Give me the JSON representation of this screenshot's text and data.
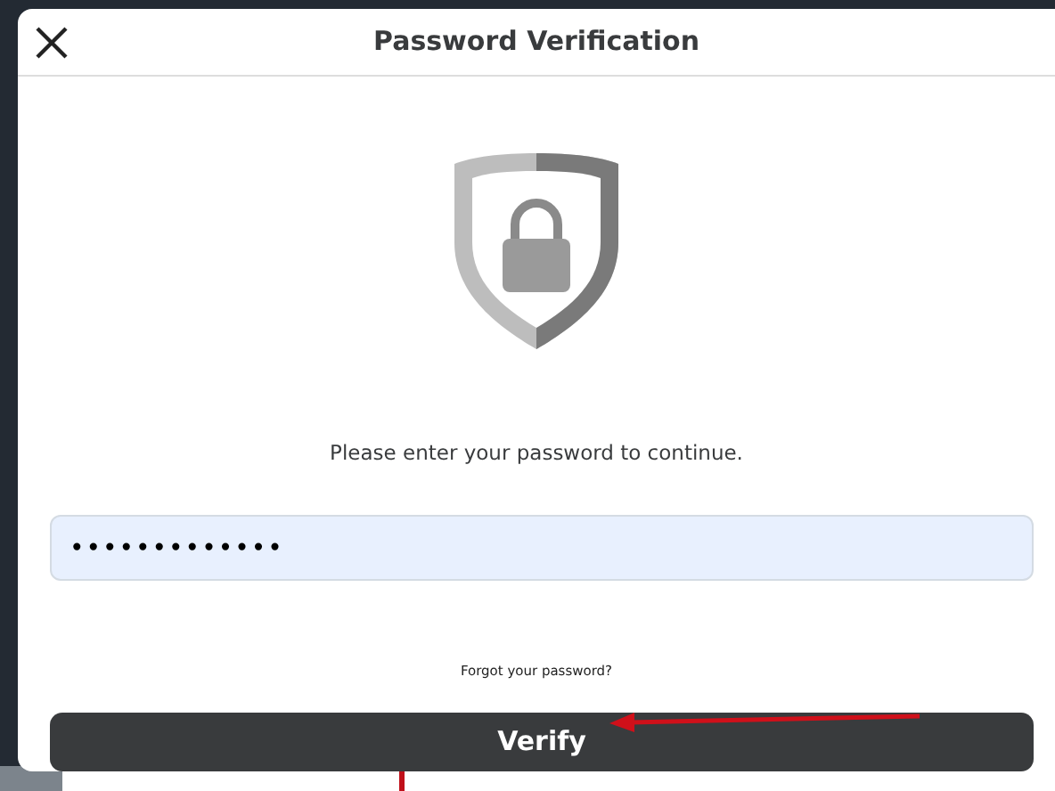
{
  "dialog": {
    "title": "Password Verification",
    "message": "Please enter your password to continue.",
    "password": {
      "value": "•••••••••••••"
    },
    "forgot_link": "Forgot your password?",
    "buttons": [
      "Verify"
    ]
  }
}
